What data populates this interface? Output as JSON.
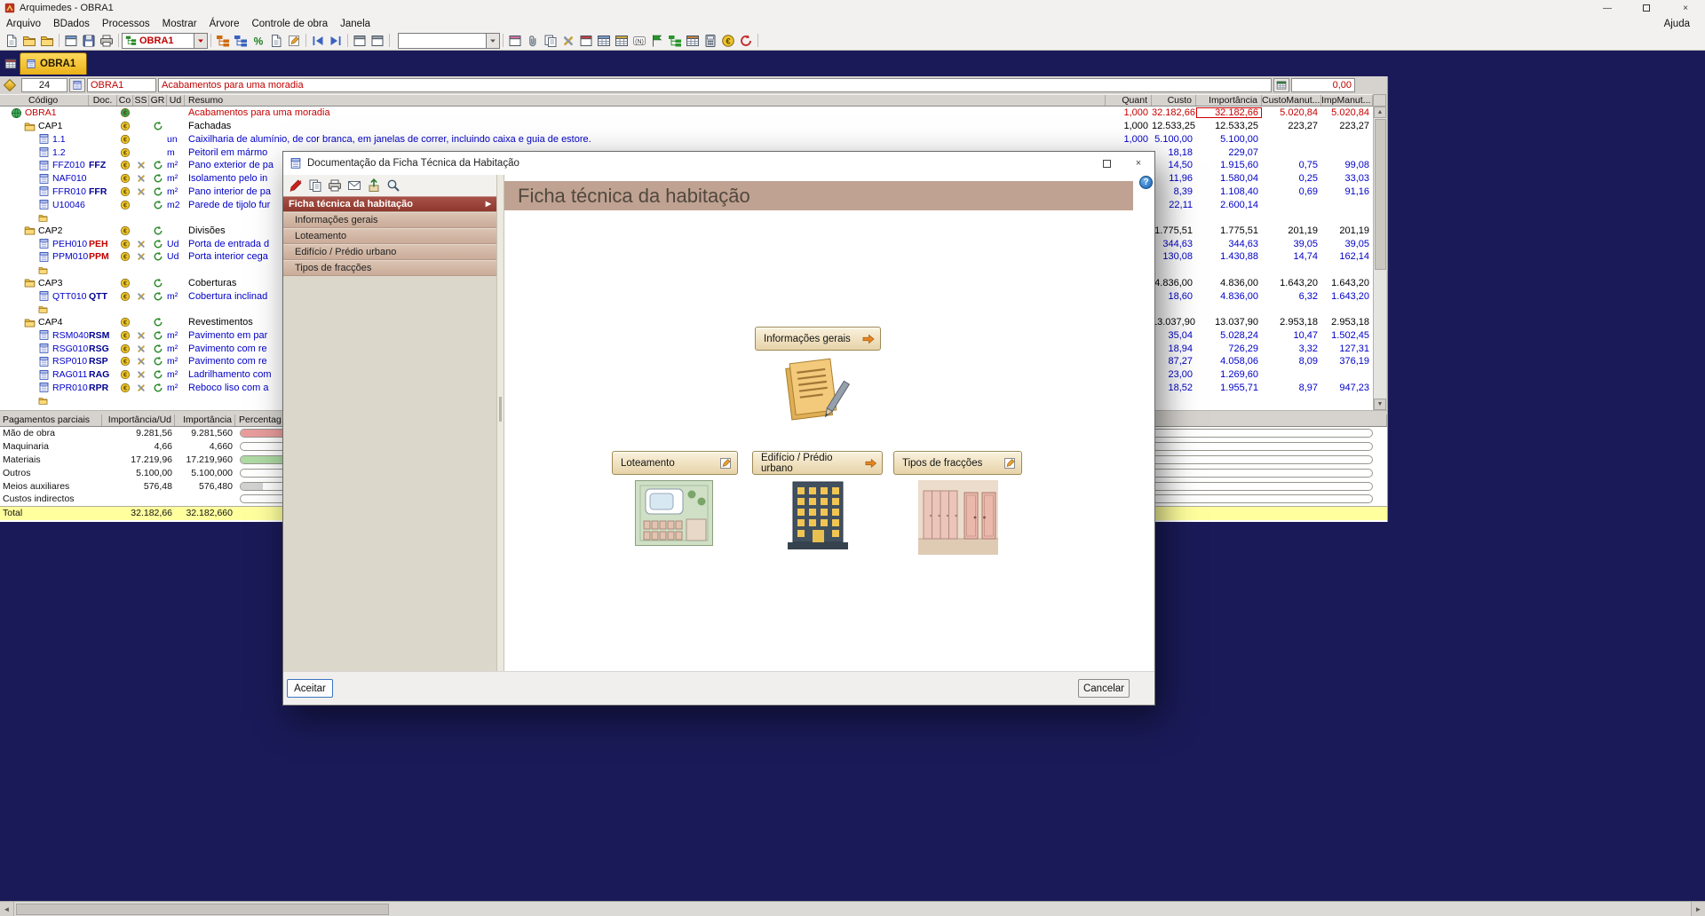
{
  "window": {
    "title": "Arquimedes - OBRA1"
  },
  "menu": {
    "items": [
      "Arquivo",
      "BDados",
      "Processos",
      "Mostrar",
      "Árvore",
      "Controle de obra",
      "Janela"
    ],
    "right_item": "Ajuda"
  },
  "main_toolbar": {
    "project_combo": {
      "value": "OBRA1"
    },
    "empty_combo_value": "",
    "groups": [
      [
        "new-document-icon",
        "open-folder-icon",
        "folder-edit-icon"
      ],
      [
        "new-window-icon",
        "save-icon",
        "print-icon"
      ]
    ],
    "groups_after_combo": [
      [
        "tree-up-icon",
        "tree-down-icon",
        "doc-percent-icon",
        "doc-values-icon",
        "doc-edit-icon"
      ],
      [
        "nav-first-icon",
        "nav-last-icon"
      ],
      [
        "window-cascade-icon",
        "window-tile-icon"
      ]
    ],
    "groups_right": [
      [
        "window-pink-icon",
        "paperclip-icon",
        "copy-doc-icon",
        "tools-icon",
        "window-red-icon",
        "table-blue-icon",
        "table-gold-icon",
        "n-badge-icon",
        "flag-green-icon",
        "tree-green-icon",
        "table-color-icon",
        "calculator-icon",
        "money-icon",
        "recycle-red-icon"
      ]
    ]
  },
  "tab": {
    "label": "OBRA1"
  },
  "control": {
    "row_number": "24",
    "code": "OBRA1",
    "description": "Acabamentos para uma moradia",
    "amount": "0,00"
  },
  "tree": {
    "columns": [
      "Código",
      "Doc.",
      "Co",
      "SS",
      "GR",
      "Ud",
      "Resumo",
      "Quant",
      "Custo",
      "Importância",
      "CustoManut...",
      "ImpManut..."
    ],
    "rows": [
      {
        "type": "root",
        "code": "OBRA1",
        "doc": "",
        "ud": "",
        "resumo": "Acabamentos para uma moradia",
        "quant": "1,000",
        "custo": "32.182,66",
        "importancia": "32.182,66",
        "custo_manut": "5.020,84",
        "imp_manut": "5.020,84",
        "icons": [
          "co"
        ],
        "selected_cell": "importancia"
      },
      {
        "type": "cap",
        "code": "CAP1",
        "doc": "",
        "ud": "",
        "resumo": "Fachadas",
        "quant": "1,000",
        "custo": "12.533,25",
        "importancia": "12.533,25",
        "custo_manut": "223,27",
        "imp_manut": "223,27",
        "icons": [
          "co",
          "gr"
        ]
      },
      {
        "type": "item",
        "code": "1.1",
        "doc": "",
        "ud": "un",
        "resumo": "Caixilharia de alumínio, de cor branca, em janelas de correr, incluindo caixa e guia de estore.",
        "quant": "1,000",
        "custo": "5.100,00",
        "importancia": "5.100,00",
        "custo_manut": "",
        "imp_manut": "",
        "icons": [
          "co"
        ]
      },
      {
        "type": "item",
        "code": "1.2",
        "doc": "",
        "ud": "m",
        "resumo": "Peitoril em mármo",
        "quant": "",
        "custo": "18,18",
        "importancia": "229,07",
        "custo_manut": "",
        "imp_manut": "",
        "icons": [
          "co"
        ]
      },
      {
        "type": "item",
        "code": "FFZ010",
        "doc": "FFZ",
        "doc_color": "navy",
        "ud": "m²",
        "resumo": "Pano exterior de pa",
        "quant": "",
        "custo": "14,50",
        "importancia": "1.915,60",
        "custo_manut": "0,75",
        "imp_manut": "99,08",
        "icons": [
          "co",
          "ss",
          "gr"
        ]
      },
      {
        "type": "item",
        "code": "NAF010",
        "doc": "",
        "ud": "m²",
        "resumo": "Isolamento pelo in",
        "quant": "",
        "custo": "11,96",
        "importancia": "1.580,04",
        "custo_manut": "0,25",
        "imp_manut": "33,03",
        "icons": [
          "co",
          "ss",
          "gr"
        ]
      },
      {
        "type": "item",
        "code": "FFR010",
        "doc": "FFR",
        "doc_color": "navy",
        "ud": "m²",
        "resumo": "Pano interior de pa",
        "quant": "",
        "custo": "8,39",
        "importancia": "1.108,40",
        "custo_manut": "0,69",
        "imp_manut": "91,16",
        "icons": [
          "co",
          "ss",
          "gr"
        ]
      },
      {
        "type": "item",
        "code": "U10046",
        "doc": "",
        "ud": "m2",
        "resumo": "Parede de tijolo fur",
        "quant": "",
        "custo": "22,11",
        "importancia": "2.600,14",
        "custo_manut": "",
        "imp_manut": "",
        "icons": [
          "co",
          "gr"
        ]
      },
      {
        "type": "sub"
      },
      {
        "type": "cap",
        "code": "CAP2",
        "doc": "",
        "ud": "",
        "resumo": "Divisões",
        "quant": "",
        "custo": "1.775,51",
        "importancia": "1.775,51",
        "custo_manut": "201,19",
        "imp_manut": "201,19",
        "icons": [
          "co",
          "gr"
        ]
      },
      {
        "type": "item",
        "code": "PEH010",
        "doc": "PEH",
        "doc_color": "red",
        "ud": "Ud",
        "resumo": "Porta de entrada d",
        "quant": "",
        "custo": "344,63",
        "importancia": "344,63",
        "custo_manut": "39,05",
        "imp_manut": "39,05",
        "icons": [
          "co",
          "ss",
          "gr"
        ]
      },
      {
        "type": "item",
        "code": "PPM010",
        "doc": "PPM",
        "doc_color": "red",
        "ud": "Ud",
        "resumo": "Porta interior cega",
        "quant": "",
        "custo": "130,08",
        "importancia": "1.430,88",
        "custo_manut": "14,74",
        "imp_manut": "162,14",
        "icons": [
          "co",
          "ss",
          "gr"
        ]
      },
      {
        "type": "sub"
      },
      {
        "type": "cap",
        "code": "CAP3",
        "doc": "",
        "ud": "",
        "resumo": "Coberturas",
        "quant": "",
        "custo": "4.836,00",
        "importancia": "4.836,00",
        "custo_manut": "1.643,20",
        "imp_manut": "1.643,20",
        "icons": [
          "co",
          "gr"
        ]
      },
      {
        "type": "item",
        "code": "QTT010",
        "doc": "QTT",
        "doc_color": "navy",
        "ud": "m²",
        "resumo": "Cobertura inclinad",
        "quant": "",
        "custo": "18,60",
        "importancia": "4.836,00",
        "custo_manut": "6,32",
        "imp_manut": "1.643,20",
        "icons": [
          "co",
          "ss",
          "gr"
        ]
      },
      {
        "type": "sub"
      },
      {
        "type": "cap",
        "code": "CAP4",
        "doc": "",
        "ud": "",
        "resumo": "Revestimentos",
        "quant": "",
        "custo": "13.037,90",
        "importancia": "13.037,90",
        "custo_manut": "2.953,18",
        "imp_manut": "2.953,18",
        "icons": [
          "co",
          "gr"
        ]
      },
      {
        "type": "item",
        "code": "RSM040",
        "doc": "RSM",
        "doc_color": "navy",
        "ud": "m²",
        "resumo": "Pavimento em par",
        "quant": "",
        "custo": "35,04",
        "importancia": "5.028,24",
        "custo_manut": "10,47",
        "imp_manut": "1.502,45",
        "icons": [
          "co",
          "ss",
          "gr"
        ]
      },
      {
        "type": "item",
        "code": "RSG010",
        "doc": "RSG",
        "doc_color": "navy",
        "ud": "m²",
        "resumo": "Pavimento com re",
        "quant": "",
        "custo": "18,94",
        "importancia": "726,29",
        "custo_manut": "3,32",
        "imp_manut": "127,31",
        "icons": [
          "co",
          "ss",
          "gr"
        ]
      },
      {
        "type": "item",
        "code": "RSP010",
        "doc": "RSP",
        "doc_color": "navy",
        "ud": "m²",
        "resumo": "Pavimento com re",
        "quant": "",
        "custo": "87,27",
        "importancia": "4.058,06",
        "custo_manut": "8,09",
        "imp_manut": "376,19",
        "icons": [
          "co",
          "ss",
          "gr"
        ]
      },
      {
        "type": "item",
        "code": "RAG011",
        "doc": "RAG",
        "doc_color": "navy",
        "ud": "m²",
        "resumo": "Ladrilhamento com",
        "quant": "",
        "custo": "23,00",
        "importancia": "1.269,60",
        "custo_manut": "",
        "imp_manut": "",
        "icons": [
          "co",
          "ss",
          "gr"
        ]
      },
      {
        "type": "item",
        "code": "RPR010",
        "doc": "RPR",
        "doc_color": "navy",
        "ud": "m²",
        "resumo": "Reboco liso com a",
        "quant": "",
        "custo": "18,52",
        "importancia": "1.955,71",
        "custo_manut": "8,97",
        "imp_manut": "947,23",
        "icons": [
          "co",
          "ss",
          "gr"
        ]
      },
      {
        "type": "sub"
      }
    ]
  },
  "payments": {
    "columns": [
      "Pagamentos parciais",
      "Importância/Ud",
      "Importância",
      "Percentag..."
    ],
    "rows": [
      {
        "label": "Mão de obra",
        "unit_amount": "9.281,56",
        "amount": "9.281,560",
        "bar_color": "#e99c9c",
        "bar_pct": 29
      },
      {
        "label": "Maquinaria",
        "unit_amount": "4,66",
        "amount": "4,660",
        "bar_color": "",
        "bar_pct": 0
      },
      {
        "label": "Materiais",
        "unit_amount": "17.219,96",
        "amount": "17.219,960",
        "bar_color": "#aedaa4",
        "bar_pct": 54
      },
      {
        "label": "Outros",
        "unit_amount": "5.100,00",
        "amount": "5.100,000",
        "bar_color": "",
        "bar_pct": 0
      },
      {
        "label": "Meios auxiliares",
        "unit_amount": "576,48",
        "amount": "576,480",
        "bar_color": "#d2d2d2",
        "bar_pct": 2
      },
      {
        "label": "Custos indirectos",
        "unit_amount": "",
        "amount": "",
        "bar_color": "",
        "bar_pct": 0
      }
    ],
    "total": {
      "label": "Total",
      "unit_amount": "32.182,66",
      "amount": "32.182,660"
    }
  },
  "dialog": {
    "title": "Documentação da Ficha Técnica da Habitação",
    "toolbar_icons": [
      "edit-red-icon",
      "copy-icon",
      "print-icon",
      "mail-icon",
      "export-icon",
      "search-icon"
    ],
    "nav": [
      {
        "label": "Ficha técnica da habitação",
        "selected": true
      },
      {
        "label": "Informações gerais",
        "selected": false
      },
      {
        "label": "Loteamento",
        "selected": false
      },
      {
        "label": "Edifício / Prédio urbano",
        "selected": false
      },
      {
        "label": "Tipos de fracções",
        "selected": false
      }
    ],
    "header": "Ficha técnica da habitação",
    "buttons": {
      "info": "Informações gerais",
      "lote": "Loteamento",
      "edificio": "Edifício / Prédio urbano",
      "tipos": "Tipos de fracções"
    },
    "accept": "Aceitar",
    "cancel": "Cancelar",
    "help": "?"
  }
}
